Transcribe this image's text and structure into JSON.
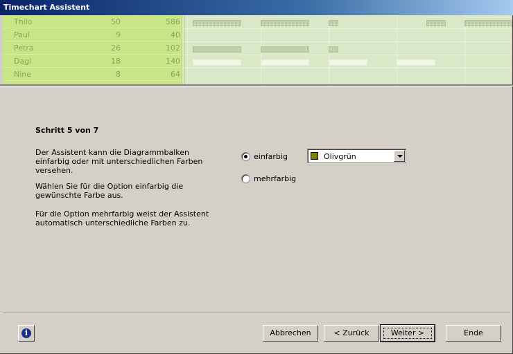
{
  "window": {
    "title": "Timechart Assistent"
  },
  "preview": {
    "rows": [
      {
        "name": "Thilo",
        "v1": "50",
        "v2": "586"
      },
      {
        "name": "Paul",
        "v1": "9",
        "v2": "40"
      },
      {
        "name": "Petra",
        "v1": "26",
        "v2": "102"
      },
      {
        "name": "Dagi",
        "v1": "18",
        "v2": "140"
      },
      {
        "name": "Nine",
        "v1": "8",
        "v2": "64"
      }
    ]
  },
  "step": {
    "heading": "Schritt 5 von 7"
  },
  "text": {
    "p1": "Der Assistent kann die Diagrammbalken einfarbig oder mit unterschiedlichen Farben versehen.",
    "p2": "Wählen Sie für die Option einfarbig die gewünschte Farbe aus.",
    "p3": "Für die Option mehrfarbig weist der Assistent automatisch unterschiedliche Farben zu."
  },
  "options": {
    "single_label": "einfarbig",
    "multi_label": "mehrfarbig",
    "selected": "einfarbig"
  },
  "color_select": {
    "value": "Olivgrün",
    "swatch_color": "#808000"
  },
  "buttons": {
    "cancel": "Abbrechen",
    "back": "< Zurück",
    "next": "Weiter >",
    "finish": "Ende",
    "info_icon": "info-icon"
  }
}
